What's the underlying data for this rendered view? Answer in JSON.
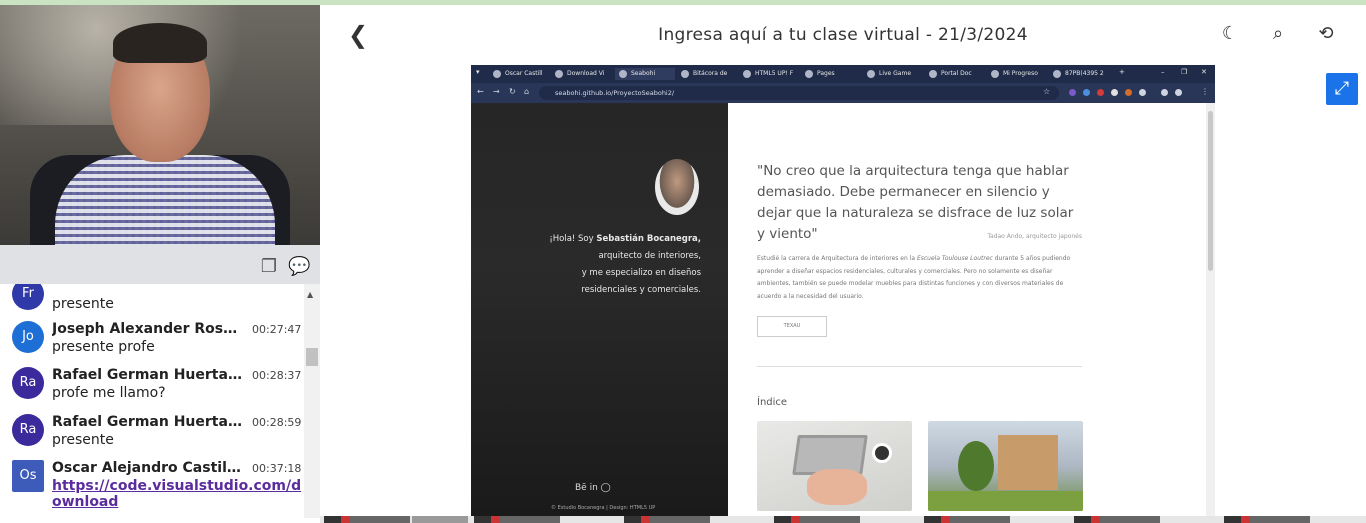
{
  "header": {
    "title": "Ingresa aquí a tu clase virtual - 21/3/2024",
    "back_icon": "chevron-left-icon",
    "theme_icon": "moon-icon",
    "search_icon": "search-icon",
    "refresh_icon": "refresh-icon",
    "expand_icon": "fullscreen-icon"
  },
  "video": {
    "description_icon": "webcam-feed"
  },
  "toolbar": {
    "copy_icon": "copy-icon",
    "chat_icon": "chat-icon"
  },
  "chat": {
    "messages": [
      {
        "initials": "Fr",
        "name": "",
        "time": "",
        "text": "presente",
        "color": "#2f3aa8"
      },
      {
        "initials": "Jo",
        "name": "Joseph Alexander Rosal...",
        "time": "00:27:47",
        "text": "presente profe",
        "color": "#1d6fd6"
      },
      {
        "initials": "Ra",
        "name": "Rafael German Huertas ...",
        "time": "00:28:37",
        "text": "profe me llamo?",
        "color": "#3a2a9c"
      },
      {
        "initials": "Ra",
        "name": "Rafael German Huertas ...",
        "time": "00:28:59",
        "text": "presente",
        "color": "#3a2a9c"
      },
      {
        "initials": "Os",
        "name": "Oscar Alejandro Castillo...",
        "time": "00:37:18",
        "link": "https://code.visualstudio.com/download",
        "color": "#3d5bb8"
      }
    ]
  },
  "browser": {
    "tabs": [
      "Oscar Castill",
      "Download Vi",
      "Seabohi",
      "Bitácora de",
      "HTML5 UP! F",
      "Pages",
      "Live Game",
      "Portal Doc",
      "Mi Progreso",
      "87PB(4395 2"
    ],
    "url": "seabohi.github.io/ProyectoSeabohi2/"
  },
  "site": {
    "intro_line1_prefix": "¡Hola! Soy ",
    "intro_name": "Sebastián Bocanegra,",
    "intro_line2": "arquitecto de interiores,",
    "intro_line3": "y me especializo en diseños",
    "intro_line4": "residenciales y comerciales.",
    "social": "Bē in ◯",
    "footer": "© Estudio Bocanegra  |  Design: HTML5 UP",
    "quote": "\"No creo que la arquitectura tenga que hablar demasiado. Debe permanecer en silencio y dejar que la naturaleza se disfrace de luz solar y viento\"",
    "quote_author": "Tadao Ando, arquitecto japonés",
    "paragraph_a": "Estudié la carrera de Arquitectura de interiores en la ",
    "paragraph_school": "Escuela Toulouse Loutrec",
    "paragraph_b": " durante 5 años pudiendo aprender a diseñar espacios residenciales, culturales y comerciales. Pero no solamente es diseñar ambientes, también se puede modelar muebles para distintas funciones y con diversos materiales de acuerdo a la necesidad del usuario.",
    "button": "TEXAU",
    "section": "Índice"
  }
}
